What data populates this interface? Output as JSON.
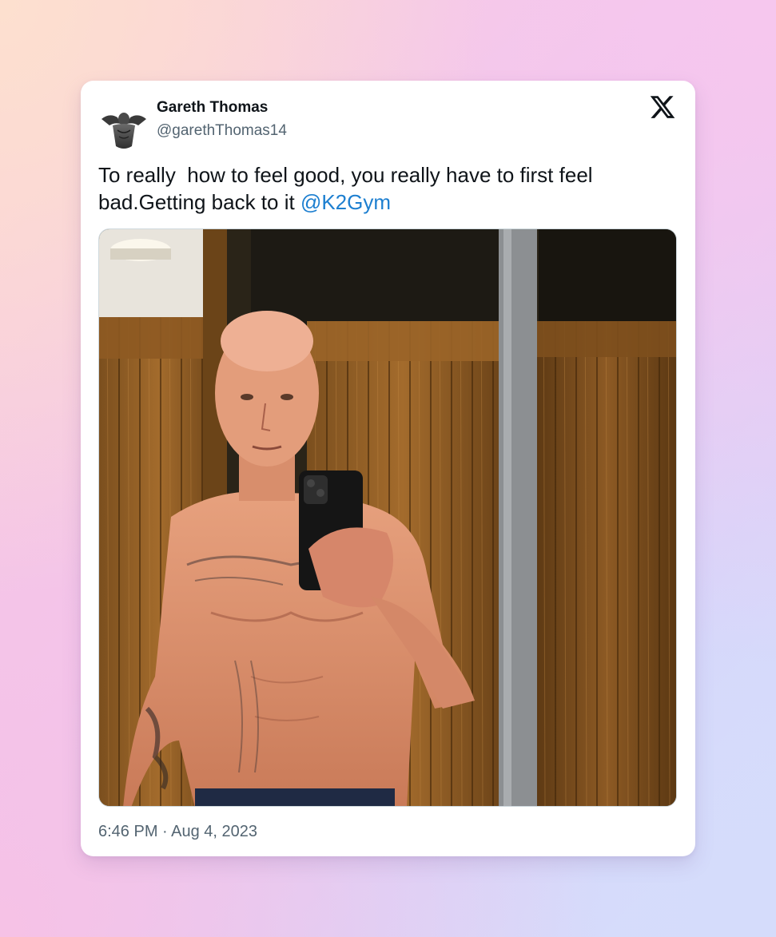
{
  "tweet": {
    "author": {
      "display_name": "Gareth Thomas",
      "handle": "@garethThomas14"
    },
    "text_before_mention": "To really  how to feel good, you really have to first feel bad.Getting back to it ",
    "mention": "@K2Gym",
    "media_alt": "mirror-selfie-photo",
    "time": "6:46 PM",
    "separator": " · ",
    "date": "Aug 4, 2023"
  },
  "icons": {
    "avatar": "avatar-silhouette-icon",
    "brand": "x-logo-icon"
  },
  "colors": {
    "mention": "#1d7fd0",
    "text": "#0f1419",
    "secondary": "#536471"
  }
}
